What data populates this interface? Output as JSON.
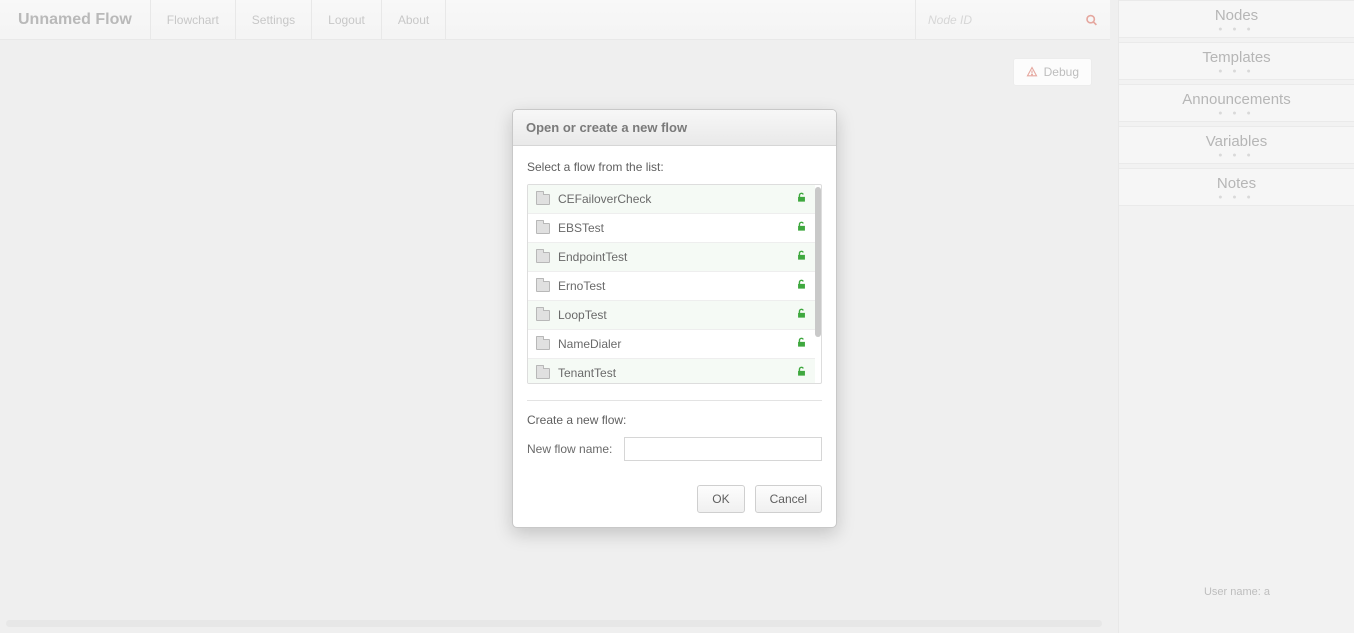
{
  "header": {
    "app_title": "Unnamed Flow",
    "nav": [
      "Flowchart",
      "Settings",
      "Logout",
      "About"
    ],
    "search_placeholder": "Node ID"
  },
  "toolbar": {
    "debug_label": "Debug"
  },
  "sidebar": {
    "panels": [
      "Nodes",
      "Templates",
      "Announcements",
      "Variables",
      "Notes"
    ],
    "user_prefix": "User name: ",
    "user_name": "a"
  },
  "dialog": {
    "title": "Open or create a new flow",
    "select_label": "Select a flow from the list:",
    "flows": [
      {
        "name": "CEFailoverCheck"
      },
      {
        "name": "EBSTest"
      },
      {
        "name": "EndpointTest"
      },
      {
        "name": "ErnoTest"
      },
      {
        "name": "LoopTest"
      },
      {
        "name": "NameDialer"
      },
      {
        "name": "TenantTest"
      }
    ],
    "create_label": "Create a new flow:",
    "name_label": "New flow name:",
    "name_value": "",
    "ok_label": "OK",
    "cancel_label": "Cancel"
  }
}
